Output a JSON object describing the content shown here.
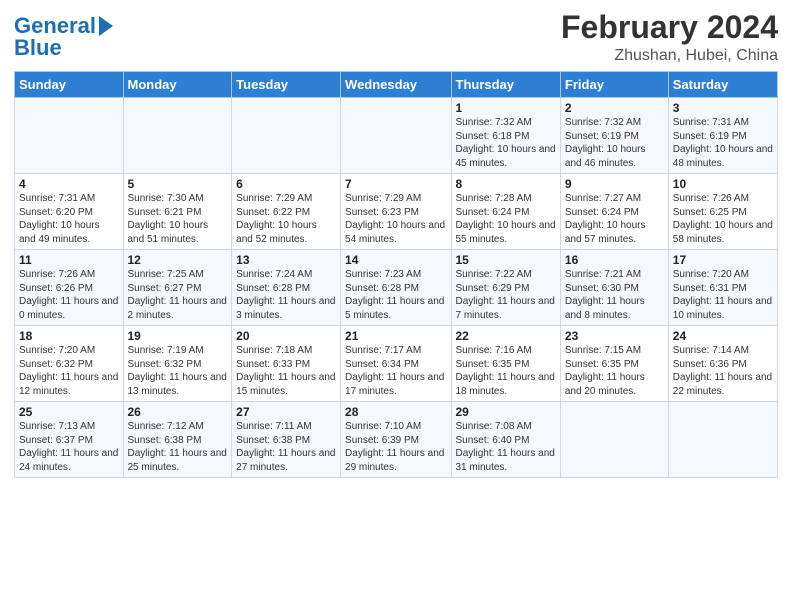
{
  "logo": {
    "line1": "General",
    "line2": "Blue"
  },
  "title": "February 2024",
  "subtitle": "Zhushan, Hubei, China",
  "days_of_week": [
    "Sunday",
    "Monday",
    "Tuesday",
    "Wednesday",
    "Thursday",
    "Friday",
    "Saturday"
  ],
  "weeks": [
    [
      {
        "num": "",
        "info": ""
      },
      {
        "num": "",
        "info": ""
      },
      {
        "num": "",
        "info": ""
      },
      {
        "num": "",
        "info": ""
      },
      {
        "num": "1",
        "info": "Sunrise: 7:32 AM\nSunset: 6:18 PM\nDaylight: 10 hours and 45 minutes."
      },
      {
        "num": "2",
        "info": "Sunrise: 7:32 AM\nSunset: 6:19 PM\nDaylight: 10 hours and 46 minutes."
      },
      {
        "num": "3",
        "info": "Sunrise: 7:31 AM\nSunset: 6:19 PM\nDaylight: 10 hours and 48 minutes."
      }
    ],
    [
      {
        "num": "4",
        "info": "Sunrise: 7:31 AM\nSunset: 6:20 PM\nDaylight: 10 hours and 49 minutes."
      },
      {
        "num": "5",
        "info": "Sunrise: 7:30 AM\nSunset: 6:21 PM\nDaylight: 10 hours and 51 minutes."
      },
      {
        "num": "6",
        "info": "Sunrise: 7:29 AM\nSunset: 6:22 PM\nDaylight: 10 hours and 52 minutes."
      },
      {
        "num": "7",
        "info": "Sunrise: 7:29 AM\nSunset: 6:23 PM\nDaylight: 10 hours and 54 minutes."
      },
      {
        "num": "8",
        "info": "Sunrise: 7:28 AM\nSunset: 6:24 PM\nDaylight: 10 hours and 55 minutes."
      },
      {
        "num": "9",
        "info": "Sunrise: 7:27 AM\nSunset: 6:24 PM\nDaylight: 10 hours and 57 minutes."
      },
      {
        "num": "10",
        "info": "Sunrise: 7:26 AM\nSunset: 6:25 PM\nDaylight: 10 hours and 58 minutes."
      }
    ],
    [
      {
        "num": "11",
        "info": "Sunrise: 7:26 AM\nSunset: 6:26 PM\nDaylight: 11 hours and 0 minutes."
      },
      {
        "num": "12",
        "info": "Sunrise: 7:25 AM\nSunset: 6:27 PM\nDaylight: 11 hours and 2 minutes."
      },
      {
        "num": "13",
        "info": "Sunrise: 7:24 AM\nSunset: 6:28 PM\nDaylight: 11 hours and 3 minutes."
      },
      {
        "num": "14",
        "info": "Sunrise: 7:23 AM\nSunset: 6:28 PM\nDaylight: 11 hours and 5 minutes."
      },
      {
        "num": "15",
        "info": "Sunrise: 7:22 AM\nSunset: 6:29 PM\nDaylight: 11 hours and 7 minutes."
      },
      {
        "num": "16",
        "info": "Sunrise: 7:21 AM\nSunset: 6:30 PM\nDaylight: 11 hours and 8 minutes."
      },
      {
        "num": "17",
        "info": "Sunrise: 7:20 AM\nSunset: 6:31 PM\nDaylight: 11 hours and 10 minutes."
      }
    ],
    [
      {
        "num": "18",
        "info": "Sunrise: 7:20 AM\nSunset: 6:32 PM\nDaylight: 11 hours and 12 minutes."
      },
      {
        "num": "19",
        "info": "Sunrise: 7:19 AM\nSunset: 6:32 PM\nDaylight: 11 hours and 13 minutes."
      },
      {
        "num": "20",
        "info": "Sunrise: 7:18 AM\nSunset: 6:33 PM\nDaylight: 11 hours and 15 minutes."
      },
      {
        "num": "21",
        "info": "Sunrise: 7:17 AM\nSunset: 6:34 PM\nDaylight: 11 hours and 17 minutes."
      },
      {
        "num": "22",
        "info": "Sunrise: 7:16 AM\nSunset: 6:35 PM\nDaylight: 11 hours and 18 minutes."
      },
      {
        "num": "23",
        "info": "Sunrise: 7:15 AM\nSunset: 6:35 PM\nDaylight: 11 hours and 20 minutes."
      },
      {
        "num": "24",
        "info": "Sunrise: 7:14 AM\nSunset: 6:36 PM\nDaylight: 11 hours and 22 minutes."
      }
    ],
    [
      {
        "num": "25",
        "info": "Sunrise: 7:13 AM\nSunset: 6:37 PM\nDaylight: 11 hours and 24 minutes."
      },
      {
        "num": "26",
        "info": "Sunrise: 7:12 AM\nSunset: 6:38 PM\nDaylight: 11 hours and 25 minutes."
      },
      {
        "num": "27",
        "info": "Sunrise: 7:11 AM\nSunset: 6:38 PM\nDaylight: 11 hours and 27 minutes."
      },
      {
        "num": "28",
        "info": "Sunrise: 7:10 AM\nSunset: 6:39 PM\nDaylight: 11 hours and 29 minutes."
      },
      {
        "num": "29",
        "info": "Sunrise: 7:08 AM\nSunset: 6:40 PM\nDaylight: 11 hours and 31 minutes."
      },
      {
        "num": "",
        "info": ""
      },
      {
        "num": "",
        "info": ""
      }
    ]
  ]
}
